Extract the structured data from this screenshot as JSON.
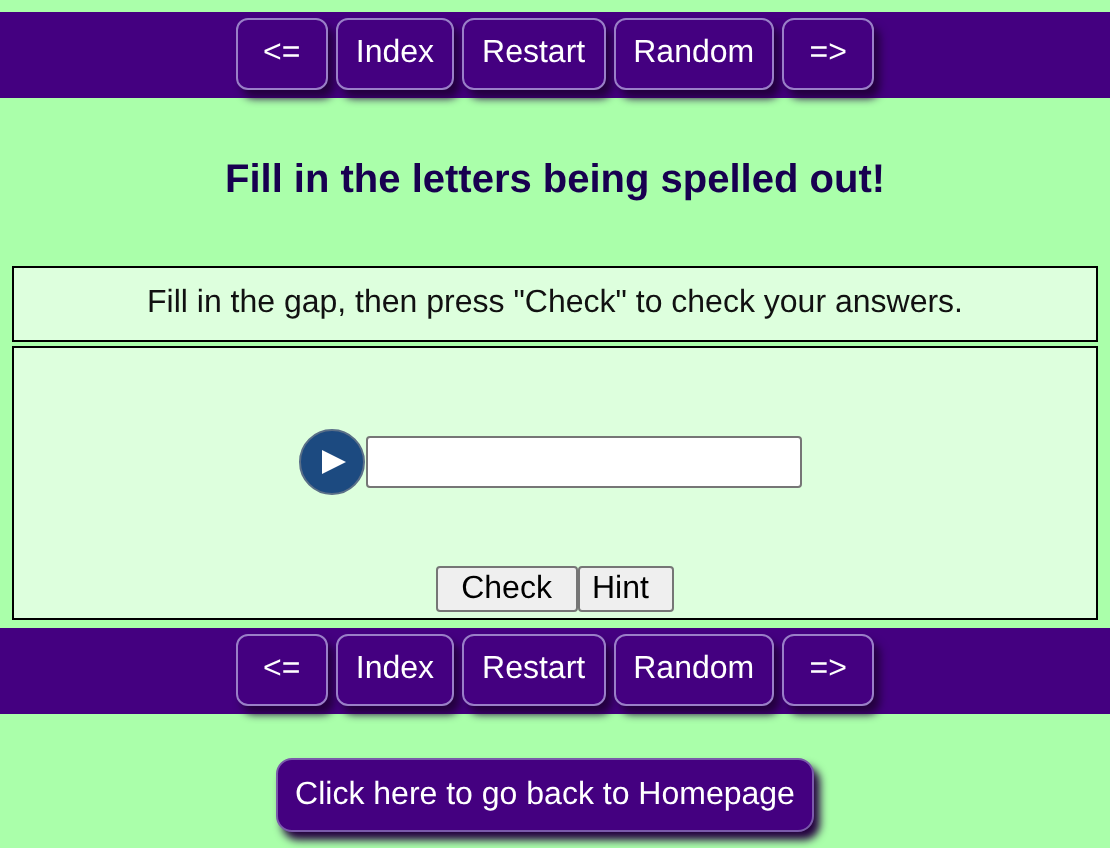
{
  "top_nav": [
    "<=",
    "Index",
    "Restart",
    "Random",
    "=>"
  ],
  "title": "Fill in the letters being spelled out!",
  "instructions": "Fill in the gap, then press \"Check\" to check your answers.",
  "exercise": {
    "buttons": [
      "Check",
      "Hint"
    ]
  },
  "bottom_nav": [
    "<=",
    "Index",
    "Restart",
    "Random",
    "=>"
  ],
  "home_button": "Click here to go back to Homepage"
}
